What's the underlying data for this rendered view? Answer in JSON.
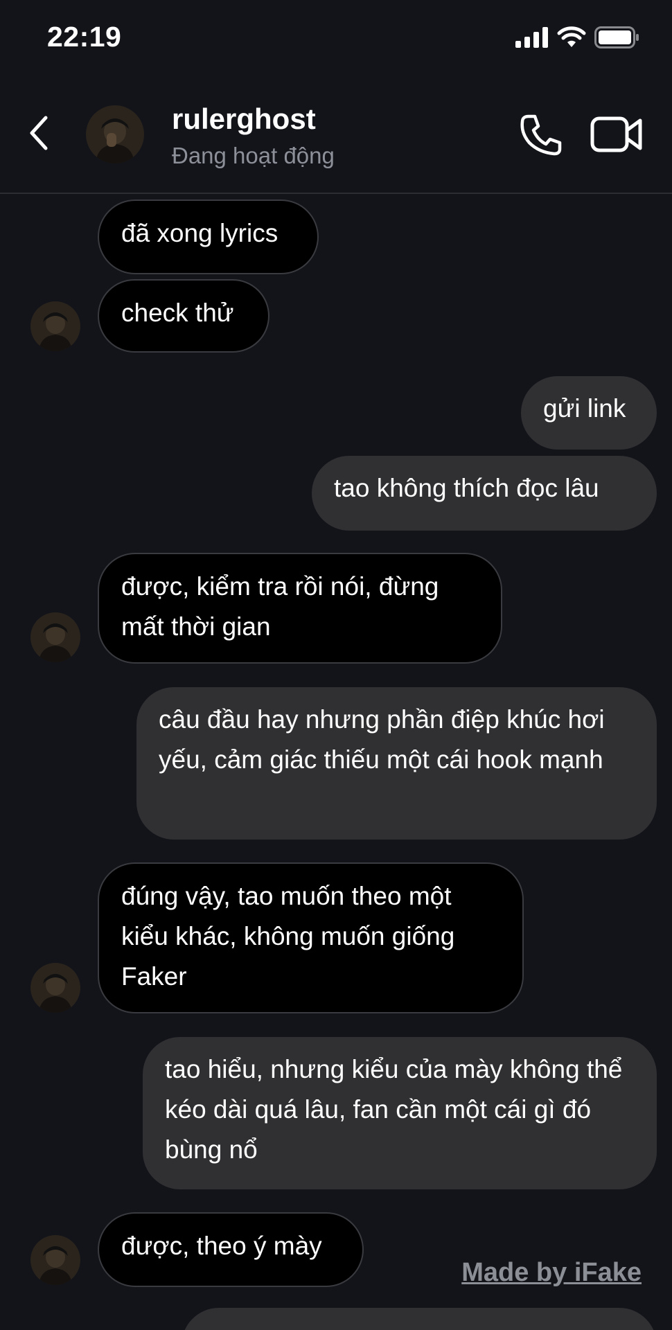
{
  "status_bar": {
    "time": "22:19"
  },
  "header": {
    "contact_name": "rulerghost",
    "contact_status": "Đang hoạt động"
  },
  "messages": [
    {
      "side": "in",
      "text": "đã xong lyrics"
    },
    {
      "side": "in",
      "text": "check thử"
    },
    {
      "side": "out",
      "text": "gửi link"
    },
    {
      "side": "out",
      "text": "tao không thích đọc lâu"
    },
    {
      "side": "in",
      "text": "được, kiểm tra rồi nói, đừng mất thời gian"
    },
    {
      "side": "out",
      "text": "câu đầu hay nhưng phần điệp khúc hơi yếu, cảm giác thiếu một cái hook mạnh"
    },
    {
      "side": "in",
      "text": "đúng vậy, tao muốn theo một kiểu khác, không muốn giống Faker"
    },
    {
      "side": "out",
      "text": "tao hiểu, nhưng kiểu của mày không thể kéo dài quá lâu, fan cần một cái gì đó bùng nổ"
    },
    {
      "side": "in",
      "text": "được, theo ý mày"
    }
  ],
  "watermark": "Made by iFake",
  "colors": {
    "background": "#13141a",
    "incoming_bubble": "#000000",
    "outgoing_bubble": "#303033",
    "muted_text": "#8e9099"
  },
  "icons": [
    "signal-icon",
    "wifi-icon",
    "battery-icon",
    "back-chevron-icon",
    "phone-icon",
    "video-camera-icon"
  ]
}
